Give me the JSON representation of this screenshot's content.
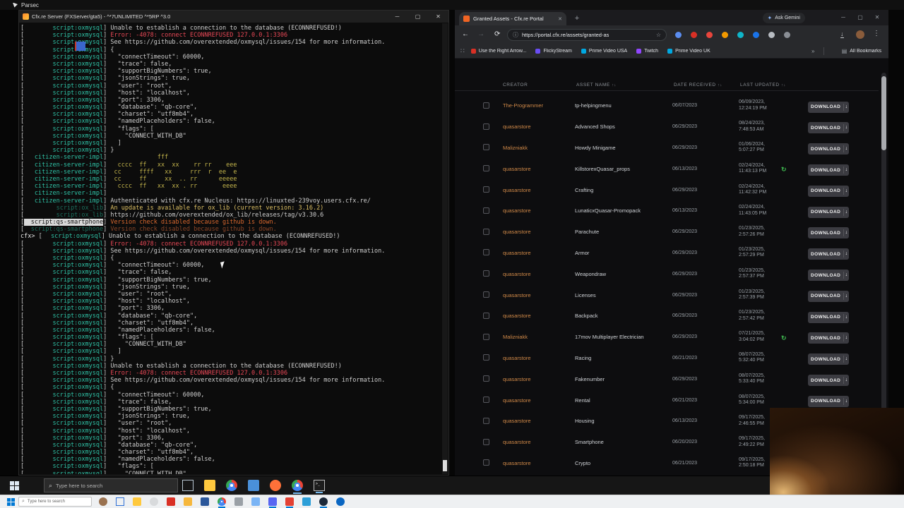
{
  "parsec": {
    "title": "Parsec"
  },
  "icons": {
    "minimize": "─",
    "maximize": "▢",
    "close": "✕",
    "plus": "+",
    "back": "←",
    "forward": "→",
    "reload": "⟳",
    "star": "☆",
    "info": "ⓘ",
    "menu": "⋮",
    "download": "↓",
    "sparkle": "✦",
    "search": "⌕",
    "chevrons": "»",
    "sort": "↑↓",
    "refresh": "↻",
    "grid": "∷",
    "allbm": "▤"
  },
  "console": {
    "title": "Cfx.re Server (FXServer/gta5) - ^*7UNLIMITED ^*5RP ^3.0",
    "lines": [
      {
        "p": "script:oxmysql",
        "t": "Unable to establish a connection to the database (ECONNREFUSED!)"
      },
      {
        "p": "script:oxmysql",
        "c": "err",
        "t": "Error: -4078: connect ECONNREFUSED 127.0.0.1:3306"
      },
      {
        "p": "script:oxmysql",
        "t": "See https://github.com/overextended/oxmysql/issues/154 for more information."
      },
      {
        "p": "script:oxmysql",
        "t": "{"
      },
      {
        "p": "script:oxmysql",
        "t": "  \"connectTimeout\": 60000,"
      },
      {
        "p": "script:oxmysql",
        "t": "  \"trace\": false,"
      },
      {
        "p": "script:oxmysql",
        "t": "  \"supportBigNumbers\": true,"
      },
      {
        "p": "script:oxmysql",
        "t": "  \"jsonStrings\": true,"
      },
      {
        "p": "script:oxmysql",
        "t": "  \"user\": \"root\","
      },
      {
        "p": "script:oxmysql",
        "t": "  \"host\": \"localhost\","
      },
      {
        "p": "script:oxmysql",
        "t": "  \"port\": 3306,"
      },
      {
        "p": "script:oxmysql",
        "t": "  \"database\": \"qb-core\","
      },
      {
        "p": "script:oxmysql",
        "t": "  \"charset\": \"utf8mb4\","
      },
      {
        "p": "script:oxmysql",
        "t": "  \"namedPlaceholders\": false,"
      },
      {
        "p": "script:oxmysql",
        "t": "  \"flags\": ["
      },
      {
        "p": "script:oxmysql",
        "t": "    \"CONNECT_WITH_DB\""
      },
      {
        "p": "script:oxmysql",
        "t": "  ]"
      },
      {
        "p": "script:oxmysql",
        "t": "}"
      },
      {
        "p": "citizen-server-impl",
        "c": "art",
        "t": "             fff"
      },
      {
        "p": "citizen-server-impl",
        "c": "art",
        "t": "  cccc  ff   xx  xx    rr rr    eee"
      },
      {
        "p": "citizen-server-impl",
        "c": "art",
        "t": " cc     ffff   xx     rrr  r  ee  e"
      },
      {
        "p": "citizen-server-impl",
        "c": "art",
        "t": " cc     ff     xx  .. rr      eeeee"
      },
      {
        "p": "citizen-server-impl",
        "c": "art",
        "t": "  cccc  ff   xx  xx . rr       eeee"
      },
      {
        "p": "citizen-server-impl",
        "t": ""
      },
      {
        "p": "citizen-server-impl",
        "t": "Authenticated with cfx.re Nucleus: https://linuxted-239voy.users.cfx.re/"
      },
      {
        "p": "script:ox_lib",
        "dm": true,
        "c": "warn",
        "t": "An update is available for ox_lib (current version: 3.16.2)"
      },
      {
        "p": "script:ox_lib",
        "dm": true,
        "t": "https://github.com/overextended/ox_lib/releases/tag/v3.30.6"
      },
      {
        "p": "script:qs-smartphone",
        "hl": true,
        "c": "ver",
        "t": "Version check disabled because github is down."
      },
      {
        "p": "script:qs-smartphone",
        "dm": true,
        "c": "verdim",
        "t": "Version check disabled because github is down."
      },
      {
        "pre": "cfx>",
        "p": "script:oxmysql",
        "t": "Unable to establish a connection to the database (ECONNREFUSED!)"
      },
      {
        "p": "script:oxmysql",
        "c": "err",
        "t": "Error: -4078: connect ECONNREFUSED 127.0.0.1:3306"
      },
      {
        "p": "script:oxmysql",
        "t": "See https://github.com/overextended/oxmysql/issues/154 for more information."
      },
      {
        "p": "script:oxmysql",
        "t": "{"
      },
      {
        "p": "script:oxmysql",
        "t": "  \"connectTimeout\": 60000,"
      },
      {
        "p": "script:oxmysql",
        "t": "  \"trace\": false,"
      },
      {
        "p": "script:oxmysql",
        "t": "  \"supportBigNumbers\": true,"
      },
      {
        "p": "script:oxmysql",
        "t": "  \"jsonStrings\": true,"
      },
      {
        "p": "script:oxmysql",
        "t": "  \"user\": \"root\","
      },
      {
        "p": "script:oxmysql",
        "t": "  \"host\": \"localhost\","
      },
      {
        "p": "script:oxmysql",
        "t": "  \"port\": 3306,"
      },
      {
        "p": "script:oxmysql",
        "t": "  \"database\": \"qb-core\","
      },
      {
        "p": "script:oxmysql",
        "t": "  \"charset\": \"utf8mb4\","
      },
      {
        "p": "script:oxmysql",
        "t": "  \"namedPlaceholders\": false,"
      },
      {
        "p": "script:oxmysql",
        "t": "  \"flags\": ["
      },
      {
        "p": "script:oxmysql",
        "t": "    \"CONNECT_WITH_DB\""
      },
      {
        "p": "script:oxmysql",
        "t": "  ]"
      },
      {
        "p": "script:oxmysql",
        "t": "}"
      },
      {
        "p": "script:oxmysql",
        "t": "Unable to establish a connection to the database (ECONNREFUSED!)"
      },
      {
        "p": "script:oxmysql",
        "c": "err",
        "t": "Error: -4078: connect ECONNREFUSED 127.0.0.1:3306"
      },
      {
        "p": "script:oxmysql",
        "t": "See https://github.com/overextended/oxmysql/issues/154 for more information."
      },
      {
        "p": "script:oxmysql",
        "t": "{"
      },
      {
        "p": "script:oxmysql",
        "t": "  \"connectTimeout\": 60000,"
      },
      {
        "p": "script:oxmysql",
        "t": "  \"trace\": false,"
      },
      {
        "p": "script:oxmysql",
        "t": "  \"supportBigNumbers\": true,"
      },
      {
        "p": "script:oxmysql",
        "t": "  \"jsonStrings\": true,"
      },
      {
        "p": "script:oxmysql",
        "t": "  \"user\": \"root\","
      },
      {
        "p": "script:oxmysql",
        "t": "  \"host\": \"localhost\","
      },
      {
        "p": "script:oxmysql",
        "t": "  \"port\": 3306,"
      },
      {
        "p": "script:oxmysql",
        "t": "  \"database\": \"qb-core\","
      },
      {
        "p": "script:oxmysql",
        "t": "  \"charset\": \"utf8mb4\","
      },
      {
        "p": "script:oxmysql",
        "t": "  \"namedPlaceholders\": false,"
      },
      {
        "p": "script:oxmysql",
        "t": "  \"flags\": ["
      },
      {
        "p": "script:oxmysql",
        "t": "    \"CONNECT_WITH_DB\""
      }
    ]
  },
  "browser": {
    "tab_title": "Granted Assets - Cfx.re Portal",
    "ask_gemini": "Ask Gemini",
    "url": "https://portal.cfx.re/assets/granted-as",
    "bookmarks": [
      {
        "label": "Use the Right Arrow...",
        "color": "#d93025"
      },
      {
        "label": "FlickyStream",
        "color": "#6a4df4"
      },
      {
        "label": "Prime Video USA",
        "color": "#00a8e1"
      },
      {
        "label": "Twitch",
        "color": "#9146ff"
      },
      {
        "label": "Prime Video UK",
        "color": "#00a8e1"
      }
    ],
    "all_bookmarks_label": "All Bookmarks",
    "extensions": [
      "#5b8def",
      "#d93025",
      "#e8453c",
      "#f29900",
      "#0fb5c9",
      "#1a73e8",
      "#b8bcc2",
      "#8a8e95"
    ]
  },
  "portal": {
    "columns": [
      {
        "label": "CREATOR",
        "sortable": false
      },
      {
        "label": "ASSET NAME",
        "sortable": true
      },
      {
        "label": "DATE RECEIVED",
        "sortable": true
      },
      {
        "label": "LAST UPDATED",
        "sortable": true
      }
    ],
    "download_label": "DOWNLOAD",
    "rows": [
      {
        "creator": "The-Programmer",
        "asset": "tp-helpingmenu",
        "received": "06/07/2023",
        "updated": "06/09/2023, 12:24:19 PM",
        "update_available": false
      },
      {
        "creator": "quasarstore",
        "asset": "Advanced Shops",
        "received": "06/29/2023",
        "updated": "08/24/2023, 7:48:53 AM",
        "update_available": false
      },
      {
        "creator": "Malizniakk",
        "asset": "Howdy Minigame",
        "received": "06/29/2023",
        "updated": "01/06/2024, 5:07:27 PM",
        "update_available": false
      },
      {
        "creator": "quasarstore",
        "asset": "KillstorexQuasar_props",
        "received": "06/13/2023",
        "updated": "02/24/2024, 11:43:13 PM",
        "update_available": true
      },
      {
        "creator": "quasarstore",
        "asset": "Crafting",
        "received": "06/29/2023",
        "updated": "02/24/2024, 11:42:32 PM",
        "update_available": false
      },
      {
        "creator": "quasarstore",
        "asset": "LunaticxQuasar-Promopack",
        "received": "06/13/2023",
        "updated": "02/24/2024, 11:43:05 PM",
        "update_available": false
      },
      {
        "creator": "quasarstore",
        "asset": "Parachute",
        "received": "06/29/2023",
        "updated": "01/23/2025, 2:57:26 PM",
        "update_available": false
      },
      {
        "creator": "quasarstore",
        "asset": "Armor",
        "received": "06/29/2023",
        "updated": "01/23/2025, 2:57:29 PM",
        "update_available": false
      },
      {
        "creator": "quasarstore",
        "asset": "Weapondraw",
        "received": "06/29/2023",
        "updated": "01/23/2025, 2:57:37 PM",
        "update_available": false
      },
      {
        "creator": "quasarstore",
        "asset": "Licenses",
        "received": "06/29/2023",
        "updated": "01/23/2025, 2:57:39 PM",
        "update_available": false
      },
      {
        "creator": "quasarstore",
        "asset": "Backpack",
        "received": "06/29/2023",
        "updated": "01/23/2025, 2:57:42 PM",
        "update_available": false
      },
      {
        "creator": "Malizniakk",
        "asset": "17mov Multiplayer Electrician",
        "received": "06/29/2023",
        "updated": "07/21/2025, 3:04:02 PM",
        "update_available": true
      },
      {
        "creator": "quasarstore",
        "asset": "Racing",
        "received": "06/21/2023",
        "updated": "08/07/2025, 5:32:40 PM",
        "update_available": false
      },
      {
        "creator": "quasarstore",
        "asset": "Fakenumber",
        "received": "06/29/2023",
        "updated": "08/07/2025, 5:33:40 PM",
        "update_available": false
      },
      {
        "creator": "quasarstore",
        "asset": "Rental",
        "received": "06/21/2023",
        "updated": "08/07/2025, 5:34:00 PM",
        "update_available": false
      },
      {
        "creator": "quasarstore",
        "asset": "Housing",
        "received": "06/13/2023",
        "updated": "09/17/2025, 2:46:55 PM",
        "update_available": true
      },
      {
        "creator": "quasarstore",
        "asset": "Smartphone",
        "received": "06/20/2023",
        "updated": "09/17/2025, 2:49:22 PM",
        "update_available": false
      },
      {
        "creator": "quasarstore",
        "asset": "Crypto",
        "received": "06/21/2023",
        "updated": "09/17/2025, 2:50:18 PM",
        "update_available": false
      }
    ]
  },
  "remote_taskbar": {
    "search_placeholder": "Type here to search",
    "icons": [
      {
        "name": "task-view-icon",
        "color": "#b9c7d2",
        "type": "outline"
      },
      {
        "name": "file-explorer-icon",
        "color": "#ffc93e",
        "type": "square"
      },
      {
        "name": "chrome-icon",
        "type": "chrome"
      },
      {
        "name": "photos-icon",
        "color": "#4a90d9",
        "type": "square"
      },
      {
        "name": "firefox-icon",
        "color": "#ff7139",
        "type": "circle"
      },
      {
        "name": "chrome-profile-icon",
        "type": "chrome",
        "active": true
      },
      {
        "name": "terminal-icon",
        "color": "#1d1d1d",
        "type": "terminal",
        "active": true
      }
    ]
  },
  "local_taskbar": {
    "search_placeholder": "Type here to search",
    "icons": [
      {
        "name": "user-avatar-icon",
        "color": "#9a7250",
        "type": "circle"
      },
      {
        "name": "task-view-icon",
        "color": "#2d6fd6",
        "type": "outline"
      },
      {
        "name": "file-explorer-icon",
        "color": "#ffc93e",
        "type": "square"
      },
      {
        "name": "settings-icon",
        "color": "#d8dadc",
        "type": "circle"
      },
      {
        "name": "pdf-icon",
        "color": "#d93025",
        "type": "square"
      },
      {
        "name": "folder-icon",
        "color": "#f6b73c",
        "type": "square"
      },
      {
        "name": "word-icon",
        "color": "#2b579a",
        "type": "square"
      },
      {
        "name": "chrome-icon",
        "type": "chrome",
        "active": true
      },
      {
        "name": "snip-tool-icon",
        "color": "#9aa0a6",
        "type": "square"
      },
      {
        "name": "photos-icon",
        "color": "#7ab4f5",
        "type": "square"
      },
      {
        "name": "discord-icon",
        "color": "#5865f2",
        "type": "square",
        "active": true
      },
      {
        "name": "installer-icon",
        "color": "#e34133",
        "type": "square",
        "active": true
      },
      {
        "name": "vscode-icon",
        "color": "#2d9fd8",
        "type": "square"
      },
      {
        "name": "steam-icon",
        "color": "#1b2838",
        "type": "circle",
        "active": true
      },
      {
        "name": "edge-icon",
        "color": "#0a66c2",
        "type": "circle"
      }
    ]
  }
}
